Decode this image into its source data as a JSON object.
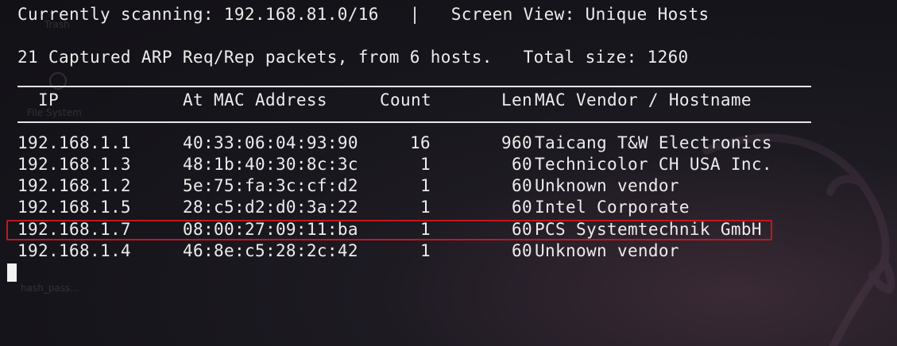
{
  "status": {
    "scan_line": "Currently scanning: 192.168.81.0/16   |   Screen View: Unique Hosts",
    "summary_line": "21 Captured ARP Req/Rep packets, from 6 hosts.   Total size: 1260"
  },
  "table": {
    "headers": {
      "ip": "IP",
      "mac": "At MAC Address",
      "count": "Count",
      "len": "Len",
      "vendor": "MAC Vendor / Hostname"
    },
    "rows": [
      {
        "ip": "192.168.1.1",
        "mac": "40:33:06:04:93:90",
        "count": "16",
        "len": "960",
        "vendor": "Taicang T&W Electronics"
      },
      {
        "ip": "192.168.1.3",
        "mac": "48:1b:40:30:8c:3c",
        "count": "1",
        "len": "60",
        "vendor": "Technicolor CH USA Inc."
      },
      {
        "ip": "192.168.1.2",
        "mac": "5e:75:fa:3c:cf:d2",
        "count": "1",
        "len": "60",
        "vendor": "Unknown vendor"
      },
      {
        "ip": "192.168.1.5",
        "mac": "28:c5:d2:d0:3a:22",
        "count": "1",
        "len": "60",
        "vendor": "Intel Corporate"
      },
      {
        "ip": "192.168.1.7",
        "mac": "08:00:27:09:11:ba",
        "count": "1",
        "len": "60",
        "vendor": "PCS Systemtechnik GmbH"
      },
      {
        "ip": "192.168.1.4",
        "mac": "46:8e:c5:28:2c:42",
        "count": "1",
        "len": "60",
        "vendor": "Unknown vendor"
      }
    ],
    "highlighted_row": "192.168.1.7"
  },
  "desktop_ghosts": {
    "trash_label": "Trash",
    "filesystem_label": "File System",
    "file_label": "hash_pass..."
  },
  "colors": {
    "background": "#15141a",
    "text": "#ececec",
    "highlight_border": "#c2171d"
  }
}
